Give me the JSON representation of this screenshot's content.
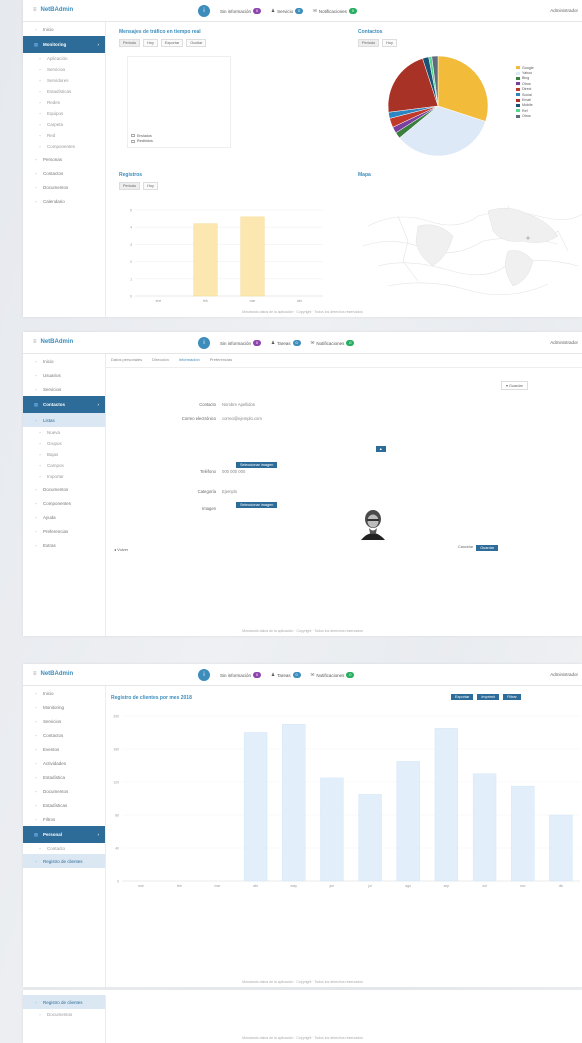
{
  "brand": "NetBAdmin",
  "topnav": {
    "btn1_label": "",
    "item1": "Sin información",
    "item2": "Servicio",
    "item3": "Tareas",
    "item4": "Notificaciones",
    "badge_purple": "0",
    "badge_blue": "0",
    "badge_green": "0",
    "user": "Administrador"
  },
  "footer": "Mostrando datos de la aplicación · Copyright · Todos los derechos reservados",
  "screen1": {
    "sidebar": [
      "Inicio",
      "Monitoring",
      "Aplicación",
      "Servicios",
      "Servidores",
      "Estadísticas",
      "Redes",
      "Equipos",
      "Carpeta",
      "Red",
      "Componentes",
      "Personas",
      "Contactos",
      "Documentos",
      "Calendario"
    ],
    "panel_messages": {
      "title": "Mensajes de tráfico en tiempo real",
      "controls": [
        "Periodo",
        "Hoy",
        "Exportar",
        "Ocultar"
      ]
    },
    "messages_legend": [
      "Enviados",
      "Recibidos"
    ],
    "panel_contacts": {
      "title": "Contactos",
      "controls": [
        "Periodo",
        "Hoy"
      ]
    },
    "pie_legend": [
      "Google",
      "Yahoo",
      "Bing",
      "Otros",
      "Direct",
      "Social",
      "Email",
      "Mobile",
      "Ref",
      "Otros"
    ],
    "panel_registers": {
      "title": "Registros",
      "controls": [
        "Periodo",
        "Hoy"
      ]
    },
    "registers_x": [
      "ene",
      "feb",
      "mar",
      "abr"
    ],
    "registers_y": [
      "5",
      "4",
      "3",
      "2",
      "1",
      "0"
    ],
    "panel_map": {
      "title": "Mapa"
    }
  },
  "screen2": {
    "sidebar": [
      "Inicio",
      "Usuarios",
      "Servicios",
      "Contactos",
      "Listas",
      "Nueva",
      "Grupos",
      "Bajas",
      "Campos",
      "Importar",
      "Documentos",
      "Componentes",
      "Ayuda",
      "Preferencias",
      "Extras"
    ],
    "tabs": [
      "Datos personales",
      "Dirección",
      "Información",
      "Preferencias"
    ],
    "form": [
      {
        "label": "Contacto",
        "value": "Nombre Apellidos"
      },
      {
        "label": "Correo electrónico",
        "value": "correo@ejemplo.com"
      },
      {
        "label": "Teléfono",
        "value": "000 000 000"
      },
      {
        "label": "Categoría",
        "value": "Ejemplo"
      },
      {
        "label": "Imagen",
        "value": ""
      }
    ],
    "select_btn": "Seleccionar imagen",
    "save_btn": "Guardar",
    "cancel_btn": "Cancelar",
    "back": "Volver"
  },
  "screen3": {
    "sidebar": [
      "Inicio",
      "Monitoring",
      "Servicios",
      "Contactos",
      "Eventos",
      "Actividades",
      "Estadística",
      "Documentos",
      "Estadísticas",
      "Filtros",
      "Personal",
      "Contacto",
      "Registro de clientes"
    ],
    "chart_title": "Registro de clientes por mes 2018",
    "toolbar": [
      "Exportar",
      "Imprimir",
      "Filtrar"
    ]
  },
  "screen4": {
    "sidebar": [
      "Registro de clientes",
      "Documentos"
    ]
  },
  "chart_data": [
    {
      "type": "pie",
      "categories": [
        "Google",
        "Yahoo",
        "Bing",
        "Otros",
        "Direct",
        "Social",
        "Email",
        "Mobile",
        "Ref",
        "Otros"
      ],
      "values": [
        30,
        34,
        2,
        2,
        3,
        2,
        22,
        2,
        1,
        2
      ]
    },
    {
      "type": "bar",
      "title": "Registros",
      "categories": [
        "ene",
        "feb",
        "mar",
        "abr"
      ],
      "values": [
        0,
        4.2,
        4.6,
        0
      ],
      "ylim": [
        0,
        5
      ]
    },
    {
      "type": "bar",
      "title": "Registro de clientes por mes 2018",
      "categories": [
        "ene",
        "feb",
        "mar",
        "abr",
        "may",
        "jun",
        "jul",
        "ago",
        "sep",
        "oct",
        "nov",
        "dic"
      ],
      "values": [
        0,
        0,
        0,
        180,
        190,
        125,
        105,
        145,
        185,
        130,
        115,
        80
      ],
      "ylim": [
        0,
        200
      ]
    }
  ],
  "colors": {
    "primary": "#2d6c99",
    "accent": "#3c8dbc",
    "bar_yellow": "#fde7b0",
    "bar_blue": "#e2effa"
  }
}
